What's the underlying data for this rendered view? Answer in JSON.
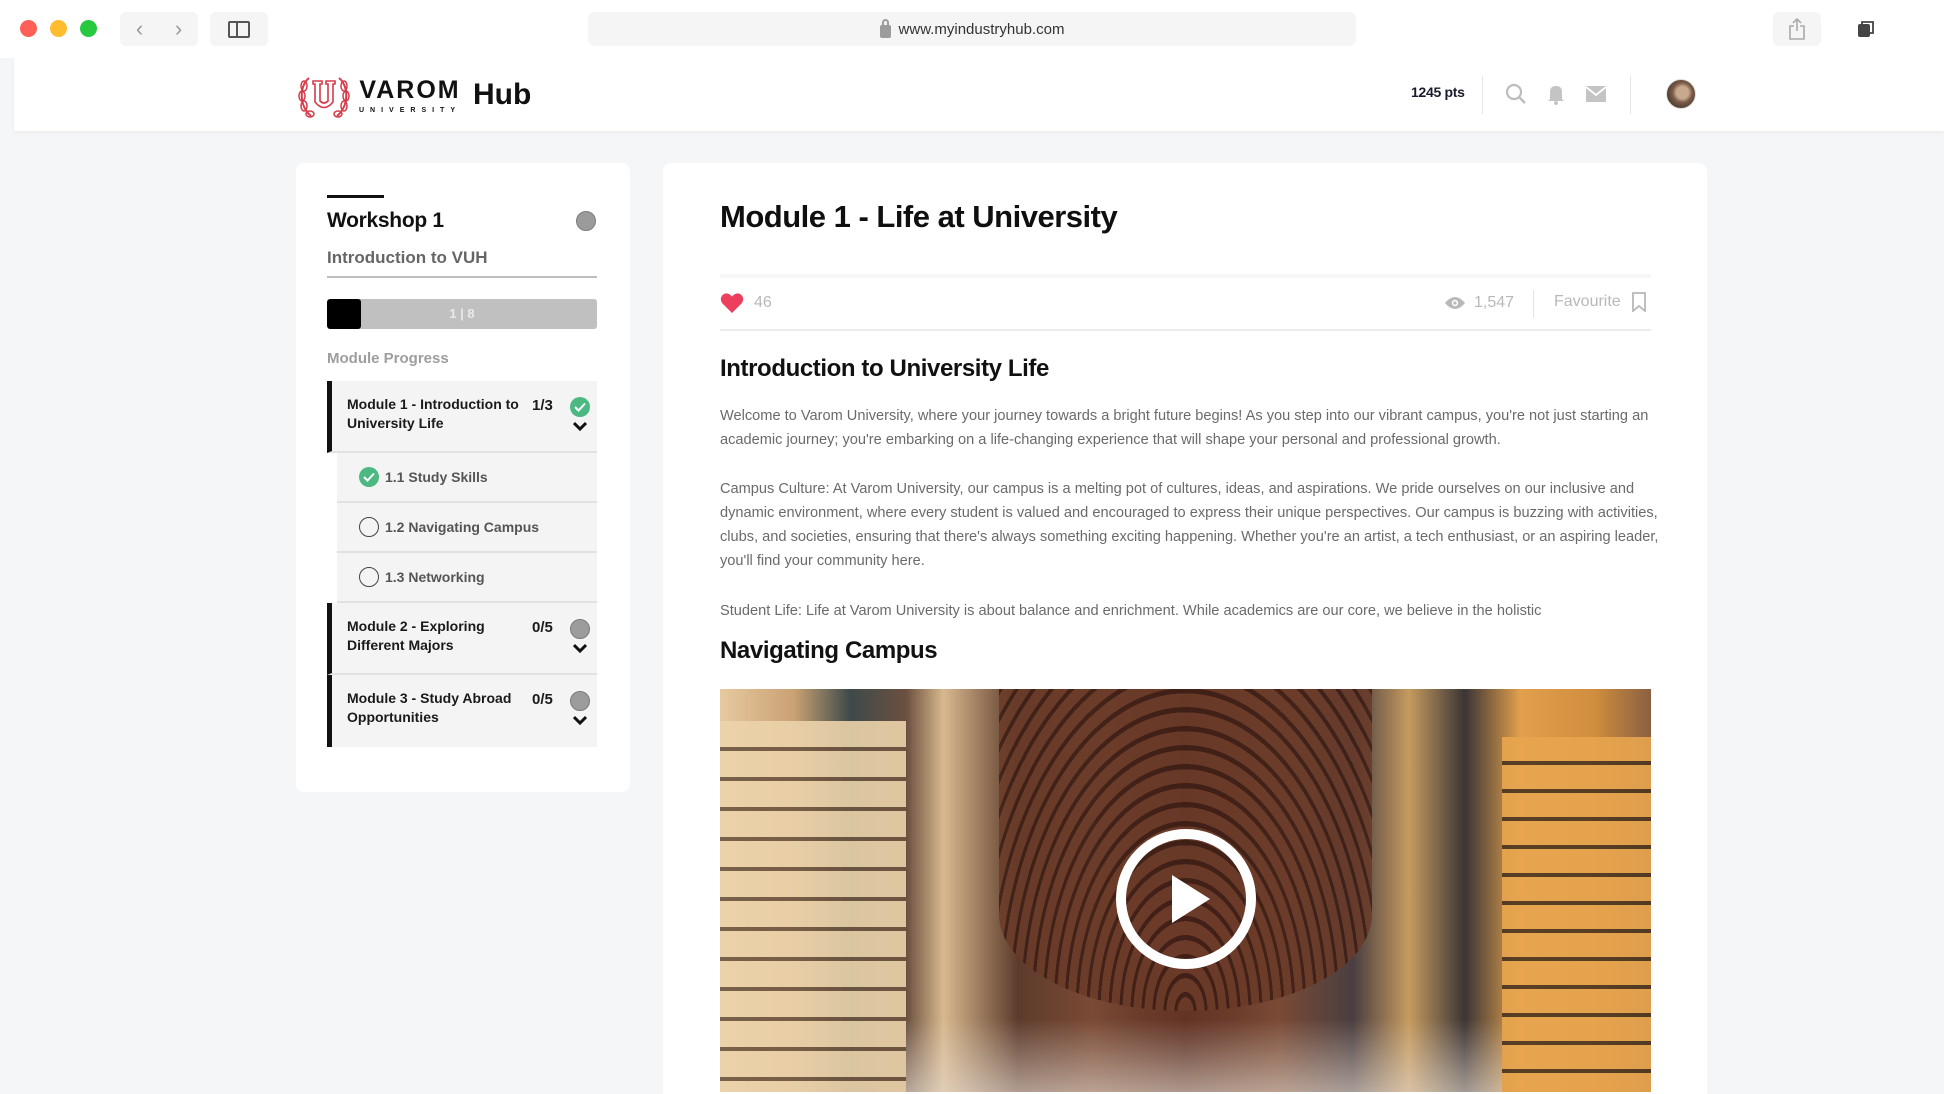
{
  "browser": {
    "url": "www.myindustryhub.com",
    "icons": {
      "back": "chevron-left-icon",
      "forward": "chevron-right-icon",
      "sidebar": "sidebar-icon",
      "lock": "lock-icon",
      "share": "share-icon",
      "tabs": "tabs-icon"
    }
  },
  "header": {
    "logo": {
      "brand": "VAROM",
      "subbrand": "UNIVERSITY",
      "product": "Hub",
      "badge_letter": "U"
    },
    "points": "1245 pts",
    "icons": [
      "search-icon",
      "bell-icon",
      "mail-icon"
    ]
  },
  "sidebar": {
    "workshop_title": "Workshop 1",
    "workshop_subtitle": "Introduction to VUH",
    "progress": {
      "current": 1,
      "total": 8,
      "label": "1 | 8"
    },
    "progress_caption": "Module Progress",
    "modules": [
      {
        "title": "Module 1 - Introduction to University Life",
        "count": "1/3",
        "status": "complete",
        "expanded": true,
        "lessons": [
          {
            "label": "1.1 Study Skills",
            "done": true
          },
          {
            "label": "1.2 Navigating Campus",
            "done": false
          },
          {
            "label": "1.3 Networking",
            "done": false
          }
        ]
      },
      {
        "title": "Module 2 - Exploring Different Majors",
        "count": "0/5",
        "status": "incomplete",
        "expanded": false
      },
      {
        "title": "Module 3 - Study Abroad Opportunities",
        "count": "0/5",
        "status": "incomplete",
        "expanded": false
      }
    ]
  },
  "main": {
    "title": "Module 1 - Life at University",
    "likes": "46",
    "views": "1,547",
    "favourite_label": "Favourite",
    "accent_like_color": "#ee3e5e",
    "sections": [
      {
        "heading": "Introduction to University Life",
        "paragraphs": [
          "Welcome to Varom University, where your journey towards a bright future begins! As you step into our vibrant campus, you're not just starting an academic journey; you're embarking on a life-changing experience that will shape your personal and professional growth.",
          "Campus Culture: At Varom University, our campus is a melting pot of cultures, ideas, and aspirations. We pride ourselves on our inclusive and dynamic environment, where every student is valued and encouraged to express their unique perspectives. Our campus is buzzing with activities, clubs, and societies, ensuring that there's always something exciting happening. Whether you're an artist, a tech enthusiast, or an aspiring leader, you'll find your community here.",
          "Student Life: Life at Varom University is about balance and enrichment. While academics are our core, we believe in the holistic"
        ]
      },
      {
        "heading": "Navigating Campus",
        "video": {
          "alt": "Library hall with tall bookshelves and arched wooden ceiling",
          "icon": "play-icon"
        }
      }
    ]
  }
}
